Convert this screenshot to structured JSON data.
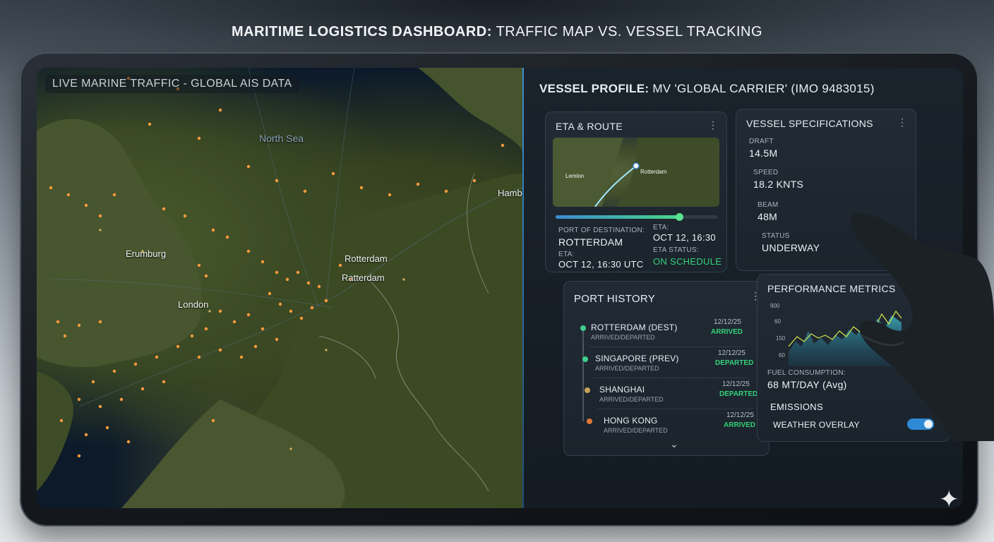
{
  "headline": {
    "bold": "MARITIME LOGISTICS DASHBOARD:",
    "rest": " TRAFFIC MAP VS. VESSEL TRACKING"
  },
  "map": {
    "title": "LIVE MARINE TRAFFIC - GLOBAL AIS DATA",
    "labels": {
      "north_sea": "North Sea",
      "hamburg": "Hamburg",
      "erumburg": "Erumburg",
      "london": "London",
      "rotterdam_1": "Rotterdam",
      "rotterdam_2": "Ratterdam"
    }
  },
  "panel": {
    "title_bold": "VESSEL PROFILE:",
    "title_rest": " MV 'GLOBAL CARRIER' (IMO 9483015)",
    "eta_route": {
      "title": "ETA & ROUTE",
      "mini_map_labels": {
        "lemlon": "Lemlon",
        "rotterdam": "Rotterdam"
      },
      "progress_percent": 76,
      "port_of_destination_key": "PORT OF DESTINATION:",
      "port_of_destination": "ROTTERDAM",
      "eta_key_1": "ETA:",
      "eta_value_1": "OCT 12, 16:30",
      "eta_key_2": "ETA:",
      "eta_value_2": "OCT 12, 16:30 UTC",
      "eta_status_key": "ETA STATUS:",
      "eta_status": "ON SCHEDULE"
    },
    "specs": {
      "title": "VESSEL SPECIFICATIONS",
      "draft_key": "DRAFT",
      "draft": "14.5M",
      "speed_key": "SPEED",
      "speed": "18.2 KNTS",
      "beam_key": "BEAM",
      "beam": "48M",
      "status_key": "STATUS",
      "status": "UNDERWAY"
    },
    "port_history": {
      "title": "PORT HISTORY",
      "items": [
        {
          "name": "ROTTERDAM (DEST)",
          "sub": "ARRIVED/DEPARTED",
          "date": "12/12/25",
          "status": "ARRIVED",
          "dot": "#3fcf8e"
        },
        {
          "name": "SINGAPORE (PREV)",
          "sub": "ARRIVED/DEPARTED",
          "date": "12/12/25",
          "status": "DEPARTED",
          "dot": "#3fcf8e"
        },
        {
          "name": "SHANGHAI",
          "sub": "ARRIVED/DEPARTED",
          "date": "12/12/25",
          "status": "DEPARTED",
          "dot": "#c9a45a"
        },
        {
          "name": "HONG KONG",
          "sub": "ARRIVED/DEPARTED",
          "date": "12/12/25",
          "status": "ARRIVED",
          "dot": "#e0773a"
        }
      ],
      "more_icon": "chevron-down-icon"
    },
    "performance": {
      "title": "PERFORMANCE METRICS",
      "y_ticks": [
        "900",
        "60",
        "150",
        "60"
      ],
      "fuel_key": "FUEL CONSUMPTION:",
      "fuel_value": "68 MT/DAY (Avg)",
      "emissions": "EMISSIONS",
      "weather_overlay": "WEATHER OVERLAY",
      "weather_overlay_on": true
    }
  },
  "colors": {
    "accent": "#2f8ad6",
    "ok": "#33d17a",
    "ship": "#ff9a3c"
  }
}
